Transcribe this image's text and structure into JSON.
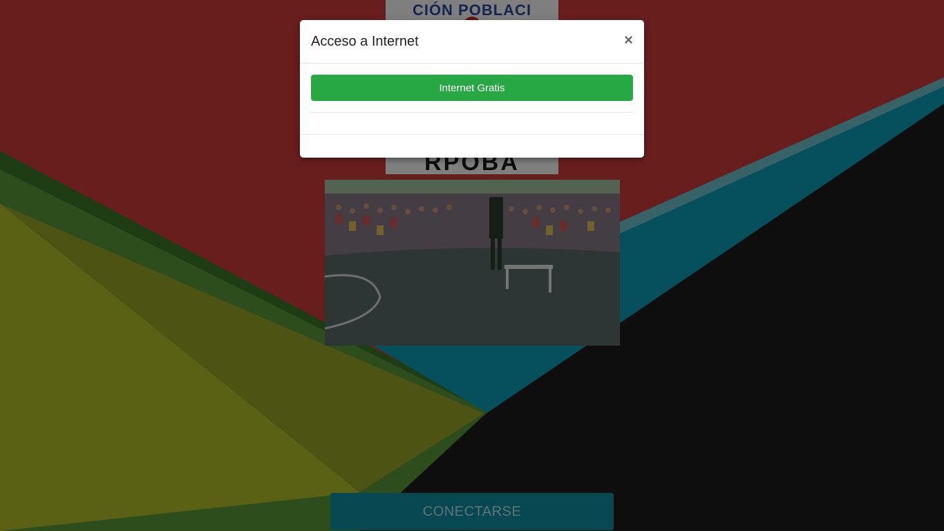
{
  "background": {
    "colors": {
      "red": "#d23c3c",
      "green_dark": "#3f7a2b",
      "green": "#4f8f34",
      "olive": "#9aa826",
      "teal": "#0aa0b8",
      "light_teal": "#6fc4d0",
      "black": "#1c1c1c"
    }
  },
  "logo": {
    "top_text": "CIÓN POBLACI",
    "bottom_text": "RPOBA"
  },
  "photo": {
    "icon": "event-photo"
  },
  "connect_button": {
    "label": "CONECTARSE",
    "color": "#1190a6"
  },
  "modal": {
    "title": "Acceso a Internet",
    "close_label": "×",
    "internet_button_label": "Internet Gratis",
    "button_color": "#28a745"
  }
}
